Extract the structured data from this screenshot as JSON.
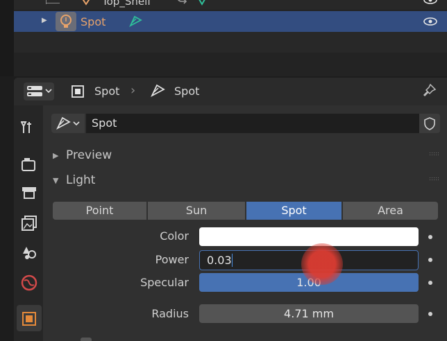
{
  "outliner": {
    "top_item": "Top_Shelf",
    "selected_item": "Spot"
  },
  "header": {
    "object_name": "Spot",
    "data_name": "Spot"
  },
  "datablock": {
    "name": "Spot"
  },
  "panels": {
    "preview_label": "Preview",
    "light_label": "Light"
  },
  "light_types": [
    {
      "label": "Point",
      "active": false
    },
    {
      "label": "Sun",
      "active": false
    },
    {
      "label": "Spot",
      "active": true
    },
    {
      "label": "Area",
      "active": false
    }
  ],
  "fields": {
    "color_label": "Color",
    "color_value": "#ffffff",
    "power_label": "Power",
    "power_value": "0.03",
    "specular_label": "Specular",
    "specular_value": "1.00",
    "specular_fraction": 1.0,
    "radius_label": "Radius",
    "radius_value": "4.71 mm"
  },
  "colors": {
    "accent": "#4772b3",
    "selection": "#334d80",
    "light_orange": "#e8a36a",
    "spot_green": "#2fbf9a"
  },
  "icons": {
    "light_object": "bulb-icon",
    "spot_data": "spot-light-icon",
    "visibility": "eye-icon",
    "pin": "pin-icon",
    "fake_user": "shield-icon"
  }
}
